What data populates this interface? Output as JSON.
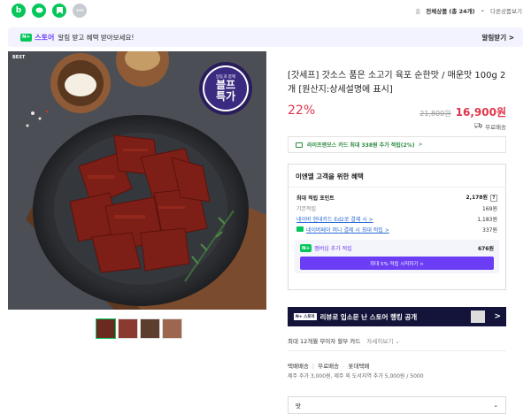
{
  "topbar": {
    "icons": [
      "blog-icon",
      "talk-icon",
      "book-icon",
      "more-icon"
    ],
    "blog_glyph": "b",
    "more_glyph": "···",
    "home_glyph": "홈",
    "all_products": "전체상품 (총 24개)",
    "other_products": "다른상품보기"
  },
  "banner": {
    "badge": "N+",
    "store": "스토어",
    "text": "알림 받고 혜택 받아보세요!",
    "action": "알림받기 >"
  },
  "image": {
    "best_tag": "BEST",
    "badge_line1": "블프",
    "badge_line2": "특가",
    "badge_top": "일동과 함께"
  },
  "product": {
    "title": "[갓세프] 갓소스 품은 소고기 육포 순한맛 / 매운맛 100g 2개 [원산지:상세설명에 표시]",
    "discount": "22%",
    "original_price": "21,800원",
    "price": "16,900원",
    "shipping": "무료배송"
  },
  "card_promo": {
    "text_bold": "라이프앤모스 카드 최대 338원 추가 적립(2%)",
    "arrow": ">"
  },
  "benefit": {
    "heading": "이엔엘 고객을 위한 혜택",
    "rows": [
      {
        "label": "최대 적립 포인트",
        "value": "2,178원",
        "help": "?"
      },
      {
        "label": "기본적립",
        "value": "169원"
      },
      {
        "label": "네이버 현대카드 Ed2로 결제 시 >",
        "value": "1,183원"
      },
      {
        "label": "네이버페이 머니 결제 시 최대 적립 >",
        "value": "337원"
      }
    ],
    "member": {
      "label": "멤버십 추가 적립",
      "value": "676원",
      "cta": "최대 5% 적립 시작하기 >"
    }
  },
  "review_banner": {
    "logo": "N+ 스토어",
    "text": "리뷰로 입소문 난 스토어 랭킹 공개",
    "arrow": ">"
  },
  "install": {
    "text": "최대 12개월 무이자 할부 카드",
    "more": "자세히보기 ⌄"
  },
  "delivery": {
    "type": "택배배송",
    "free": "무료배송",
    "carrier": "롯데택배",
    "extra": "제주 추가 3,000원, 제주 외 도서지역 추가 5,000원 / 5000"
  },
  "option": {
    "label": "맛",
    "chevron": "⌄"
  }
}
